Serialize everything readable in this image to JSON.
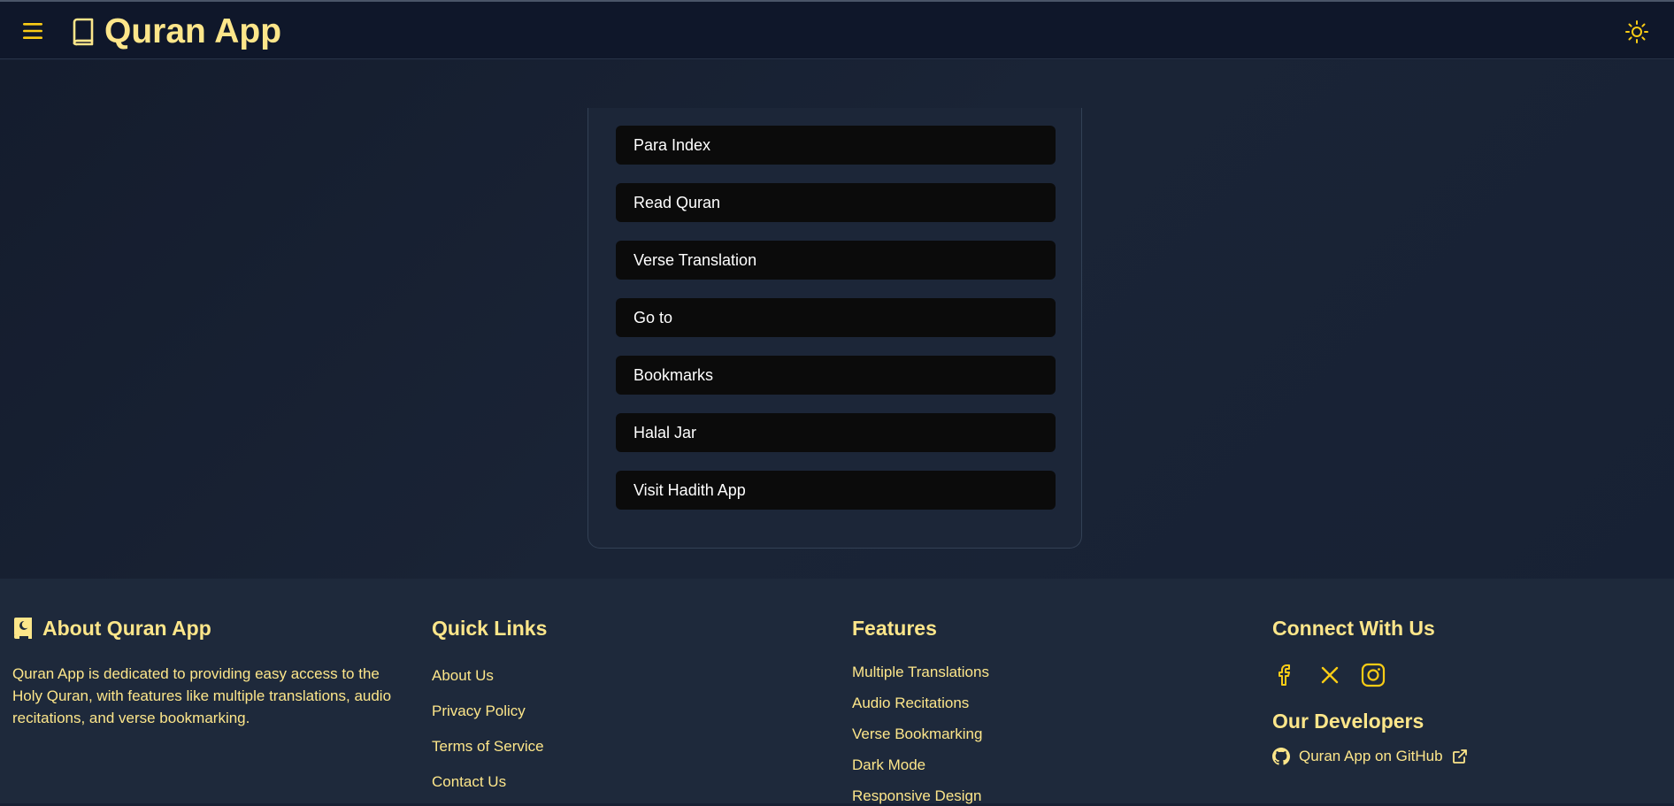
{
  "header": {
    "title": "Quran App",
    "menu_icon": "hamburger-menu-icon",
    "logo_icon": "book-icon",
    "theme_icon": "sun-icon",
    "accent_color": "#fde68a",
    "icon_color": "#facc15"
  },
  "menu": {
    "items": [
      {
        "label": "Para Index"
      },
      {
        "label": "Read Quran"
      },
      {
        "label": "Verse Translation"
      },
      {
        "label": "Go to"
      },
      {
        "label": "Bookmarks"
      },
      {
        "label": "Halal Jar"
      },
      {
        "label": "Visit Hadith App"
      }
    ]
  },
  "footer": {
    "about": {
      "heading": "About Quran App",
      "icon": "quran-book-icon",
      "text": "Quran App is dedicated to providing easy access to the Holy Quran, with features like multiple translations, audio recitations, and verse bookmarking."
    },
    "quick_links": {
      "heading": "Quick Links",
      "items": [
        "About Us",
        "Privacy Policy",
        "Terms of Service",
        "Contact Us"
      ]
    },
    "features": {
      "heading": "Features",
      "items": [
        "Multiple Translations",
        "Audio Recitations",
        "Verse Bookmarking",
        "Dark Mode",
        "Responsive Design"
      ]
    },
    "connect": {
      "heading": "Connect With Us",
      "social_icons": [
        "facebook-icon",
        "x-twitter-icon",
        "instagram-icon"
      ],
      "developers_heading": "Our Developers",
      "github_label": "Quran App on GitHub"
    }
  }
}
